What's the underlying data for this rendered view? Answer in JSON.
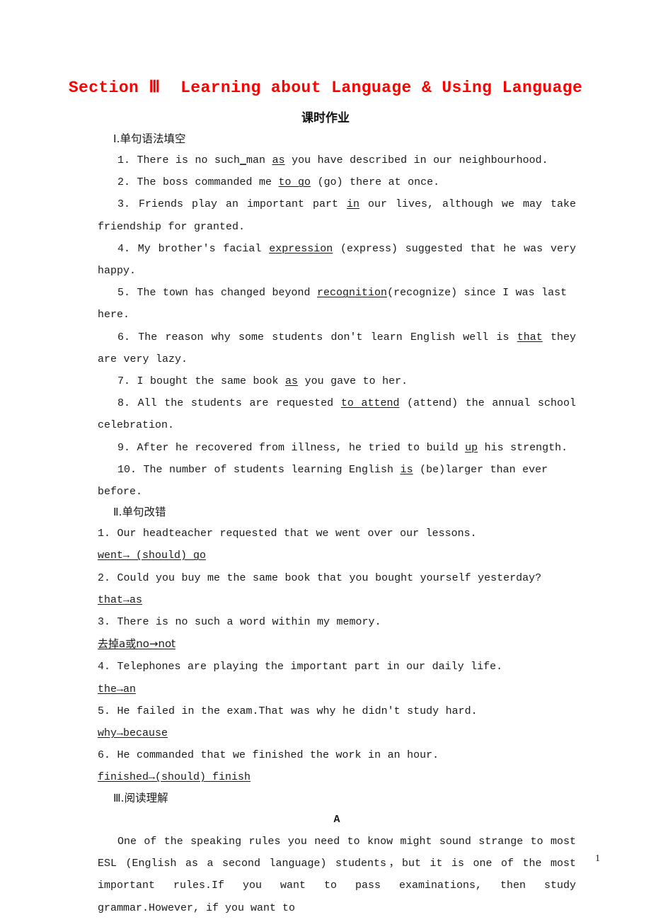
{
  "document": {
    "title": "Section Ⅲ  Learning about Language & Using Language",
    "subtitle": "课时作业",
    "title_color": "#ff0000",
    "page_number": "1"
  },
  "section_one": {
    "heading": "Ⅰ.单句语法填空",
    "items": [
      {
        "pre": "1. There is no such",
        "joiner": "_",
        "mid": "man ",
        "answer": "as",
        "post": " you have described in our neighbourhood."
      },
      {
        "pre": "2. The boss commanded me ",
        "answer": "to go",
        "post": " (go) there at once."
      },
      {
        "pre": "3. Friends play an important part ",
        "answer": "in",
        "post": " our lives, although we may take friendship for granted."
      },
      {
        "pre": "4. My brother's facial ",
        "answer": "expression",
        "post": " (express) suggested that he was very happy."
      },
      {
        "pre": "5. The town has changed beyond ",
        "answer": "recognition",
        "post": "(recognize) since I was last here."
      },
      {
        "pre": "6. The reason why some students don't learn English well is ",
        "answer": "that",
        "post": " they are very lazy."
      },
      {
        "pre": "7. I bought the same book ",
        "answer": "as",
        "post": " you gave to her."
      },
      {
        "pre": "8. All the students are requested ",
        "answer": "to attend",
        "post": " (attend) the annual school celebration."
      },
      {
        "pre": "9. After he recovered from illness, he tried to build ",
        "answer": "up",
        "post": " his strength."
      },
      {
        "pre": "10. The number of students learning English ",
        "answer": "is",
        "post": " (be)larger than ever before."
      }
    ]
  },
  "section_two": {
    "heading": "Ⅱ.单句改错",
    "items": [
      {
        "sentence": "1. Our headteacher requested that we went over our lessons.",
        "correction": "went→ (should) go",
        "correction_inline": false
      },
      {
        "sentence": "2. Could you buy me the same book that you bought yourself yesterday? ",
        "correction": "that→as",
        "correction_inline": true
      },
      {
        "sentence": "3. There is no such a word within my memory.",
        "correction": "去掉a或no→not",
        "correction_inline": false
      },
      {
        "sentence": "4. Telephones are playing the important part in our daily life.",
        "correction": "the→an",
        "correction_inline": false
      },
      {
        "sentence": "5. He failed in the exam.That was why he didn't study hard.",
        "correction": "why→because",
        "correction_inline": false
      },
      {
        "sentence": "6. He commanded that we finished the work in an hour.",
        "correction": "finished→(should) finish",
        "correction_inline": false
      }
    ]
  },
  "section_three": {
    "heading": "Ⅲ.阅读理解",
    "passage_label": "A",
    "passage_text": "One of the speaking rules you need to know might sound strange to most ESL (English as a second language) students，but it is one of the most important rules.If you want to pass examinations, then study grammar.However, if you want to"
  }
}
